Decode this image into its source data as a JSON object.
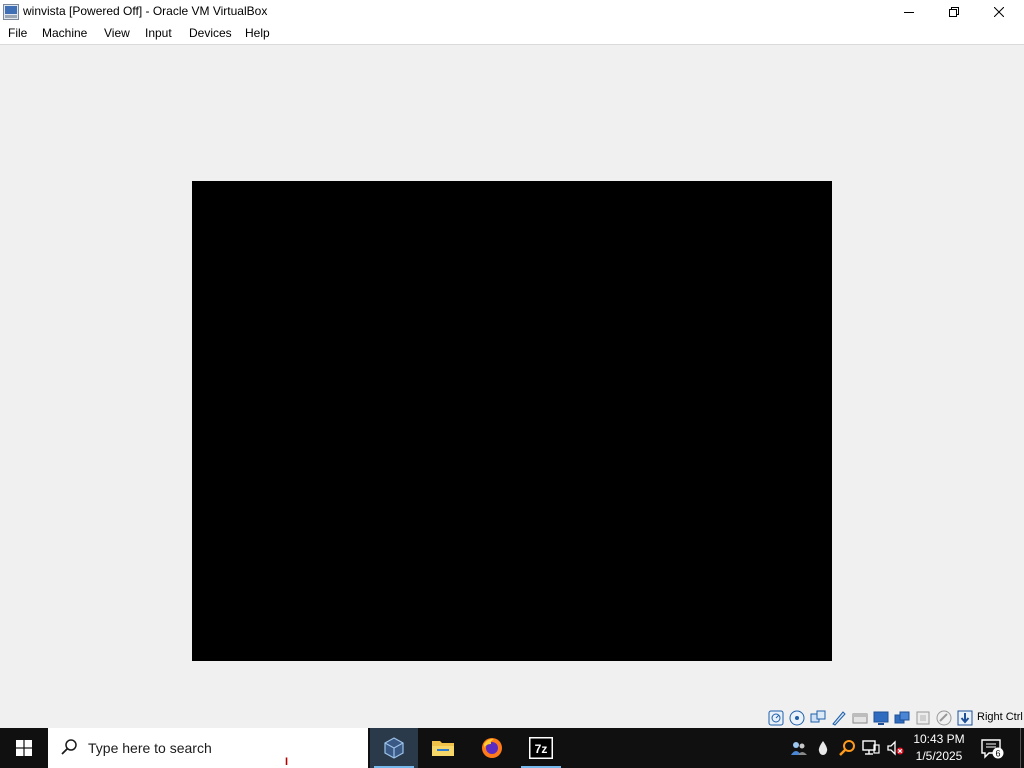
{
  "window": {
    "title": "winvista [Powered Off] - Oracle VM VirtualBox",
    "app_icon": "virtualbox-vm-icon",
    "controls": [
      "minimize-icon",
      "restore-icon",
      "close-icon"
    ]
  },
  "menubar": {
    "items": [
      {
        "label": "File"
      },
      {
        "label": "Machine"
      },
      {
        "label": "View"
      },
      {
        "label": "Input"
      },
      {
        "label": "Devices"
      },
      {
        "label": "Help"
      }
    ]
  },
  "vm": {
    "state": "Powered Off",
    "screen_color": "#000000"
  },
  "statusbar": {
    "icons": [
      "hard-disk-icon",
      "optical-drive-icon",
      "audio-icon",
      "network-icon",
      "usb-icon",
      "shared-folders-icon",
      "display-icon",
      "recording-icon",
      "cpu-icon",
      "mouse-integration-icon",
      "keyboard-icon"
    ],
    "host_key": "Right Ctrl"
  },
  "taskbar": {
    "search_placeholder": "Type here to search",
    "cursor_glyph": "I",
    "apps": [
      {
        "name": "virtualbox-icon",
        "active": true
      },
      {
        "name": "file-explorer-icon",
        "active": false
      },
      {
        "name": "firefox-icon",
        "active": false
      },
      {
        "name": "7zip-icon",
        "active": false,
        "label": "7z"
      }
    ],
    "tray_icons": [
      "people-icon",
      "water-drop-icon",
      "magnifier-icon",
      "network-icon",
      "volume-muted-icon"
    ],
    "clock": {
      "time": "10:43 PM",
      "date": "1/5/2025"
    },
    "notification_count": "6"
  },
  "colors": {
    "accent": "#0078d7",
    "taskbar": "#101010",
    "window_bg": "#f0f0f0"
  }
}
